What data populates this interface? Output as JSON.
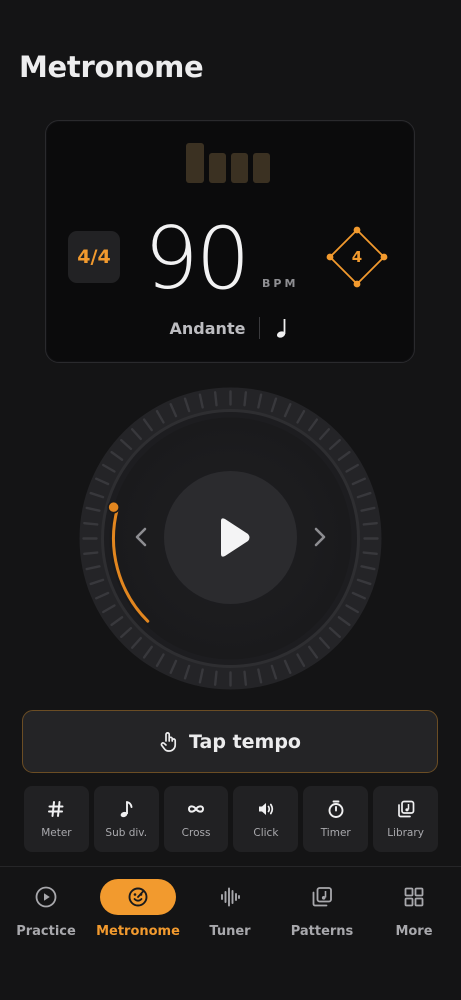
{
  "header": {
    "title": "Metronome"
  },
  "display": {
    "time_signature": "4/4",
    "bpm": "90",
    "bpm_unit": "BPM",
    "accent_count": "4",
    "tempo_name": "Andante",
    "beats_total": 4,
    "note_icon": "quarter-note-icon"
  },
  "transport": {
    "play_icon": "play-icon",
    "prev_icon": "chevron-left-icon",
    "next_icon": "chevron-right-icon"
  },
  "tap": {
    "label": "Tap tempo",
    "icon": "hand-tap-icon"
  },
  "tools": [
    {
      "label": "Meter",
      "icon": "hash-icon"
    },
    {
      "label": "Sub div.",
      "icon": "eighth-note-icon"
    },
    {
      "label": "Cross",
      "icon": "infinity-icon"
    },
    {
      "label": "Click",
      "icon": "speaker-icon"
    },
    {
      "label": "Timer",
      "icon": "stopwatch-icon"
    },
    {
      "label": "Library",
      "icon": "music-library-icon"
    }
  ],
  "nav": [
    {
      "label": "Practice",
      "icon": "play-circle-icon",
      "active": false
    },
    {
      "label": "Metronome",
      "icon": "metronome-icon",
      "active": true
    },
    {
      "label": "Tuner",
      "icon": "waveform-icon",
      "active": false
    },
    {
      "label": "Patterns",
      "icon": "patterns-icon",
      "active": false
    },
    {
      "label": "More",
      "icon": "grid-icon",
      "active": false
    }
  ],
  "colors": {
    "accent": "#f29a2e",
    "background": "#141415",
    "card": "#0b0b0c",
    "surface": "#212123"
  }
}
